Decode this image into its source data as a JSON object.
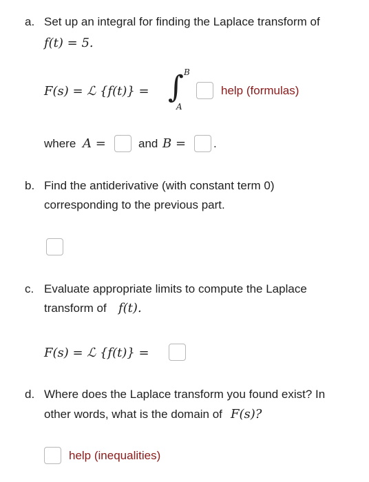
{
  "part_a": {
    "label": "a.",
    "line1": "Set up an integral for finding the Laplace transform of",
    "func": "f(t) = 5.",
    "formula_lhs": "F(s) = ℒ {f(t)} =",
    "int_upper": "B",
    "int_lower": "A",
    "help": "help (formulas)",
    "where": "where",
    "a_eq": "A =",
    "and": "and",
    "b_eq": "B =",
    "period": "."
  },
  "part_b": {
    "label": "b.",
    "line1": "Find the antiderivative (with constant term 0)",
    "line2": "corresponding to the previous part."
  },
  "part_c": {
    "label": "c.",
    "line1": "Evaluate appropriate limits to compute the Laplace",
    "line2_pre": "transform of",
    "line2_math": "f(t).",
    "formula_lhs": "F(s) = ℒ {f(t)} ="
  },
  "part_d": {
    "label": "d.",
    "line1": "Where does the Laplace transform you found exist? In",
    "line2_pre": "other words, what is the domain of",
    "line2_math": "F(s)?",
    "help": "help (inequalities)"
  }
}
